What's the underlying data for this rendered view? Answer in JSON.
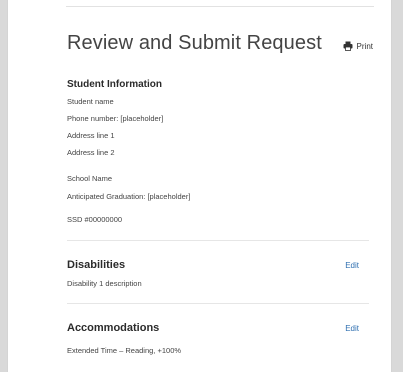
{
  "page": {
    "title": "Review and Submit Request",
    "print_label": "Print"
  },
  "student_info": {
    "heading": "Student Information",
    "lines": [
      "Student name",
      "Phone number: [placeholder]",
      "Address line 1",
      "Address line 2"
    ],
    "school_lines": [
      "School Name",
      "Anticipated Graduation: [placeholder]"
    ],
    "ssd": "SSD #00000000"
  },
  "disabilities": {
    "heading": "Disabilities",
    "edit_label": "Edit",
    "lines": [
      "Disability 1 description"
    ]
  },
  "accommodations": {
    "heading": "Accommodations",
    "edit_label": "Edit",
    "lines": [
      "Extended Time – Reading, +100%"
    ]
  },
  "colors": {
    "link": "#2f6fb0",
    "text": "#2b2b2b",
    "background": "#ffffff"
  }
}
